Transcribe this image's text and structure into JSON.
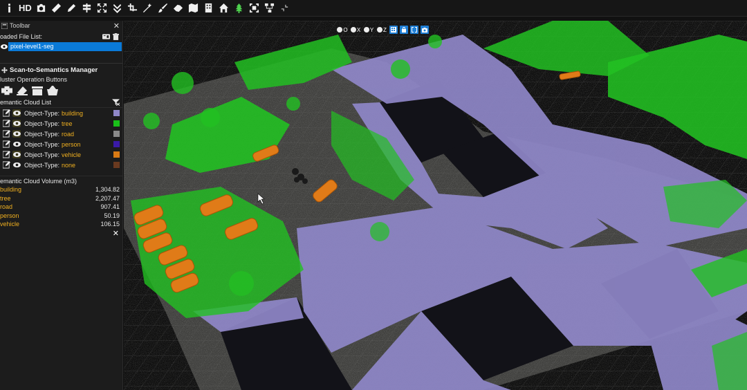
{
  "toolbar": {
    "hd_label": "HD",
    "icons": [
      "info-icon",
      "hd-text",
      "camera-icon",
      "ruler-icon",
      "pencil-icon",
      "signpost-icon",
      "fit-view-icon",
      "chevrons-down-icon",
      "crop-icon",
      "magic-wand-icon",
      "brush-icon",
      "pipe-icon",
      "map-icon",
      "building-icon",
      "house-icon",
      "tree-icon",
      "frame-icon",
      "network-icon",
      "collapse-icon"
    ]
  },
  "panel": {
    "title": "Toolbar",
    "loaded_label": "oaded File List:",
    "files": [
      {
        "name": "pixel-level1-seg"
      }
    ],
    "manager_title": "Scan-to-Semantics Manager",
    "cluster_label": "luster Operation Buttons",
    "semantic_list_label": "emantic Cloud List",
    "object_type_label": "Object-Type:",
    "semantic_rows": [
      {
        "type": "building",
        "color": "#8f87c8"
      },
      {
        "type": "tree",
        "color": "#19c019"
      },
      {
        "type": "road",
        "color": "#8a8a8a"
      },
      {
        "type": "person",
        "color": "#3a1aa8"
      },
      {
        "type": "vehicle",
        "color": "#d97a14"
      },
      {
        "type": "none",
        "color": "#6a3a20"
      }
    ],
    "volume_label": "emantic Cloud Volume (m3)",
    "volumes": [
      {
        "name": "building",
        "value": "1,304.82"
      },
      {
        "name": "tree",
        "value": "2,207.47"
      },
      {
        "name": "road",
        "value": "907.41"
      },
      {
        "name": "person",
        "value": "50.19"
      },
      {
        "name": "vehicle",
        "value": "106.15"
      }
    ]
  },
  "view_controls": {
    "labels": [
      "O",
      "X",
      "Y",
      "Z"
    ]
  },
  "colors": {
    "building": "#8f87c8",
    "tree": "#22c022",
    "vehicle": "#e07b18",
    "selection": "#0a7ad8"
  }
}
